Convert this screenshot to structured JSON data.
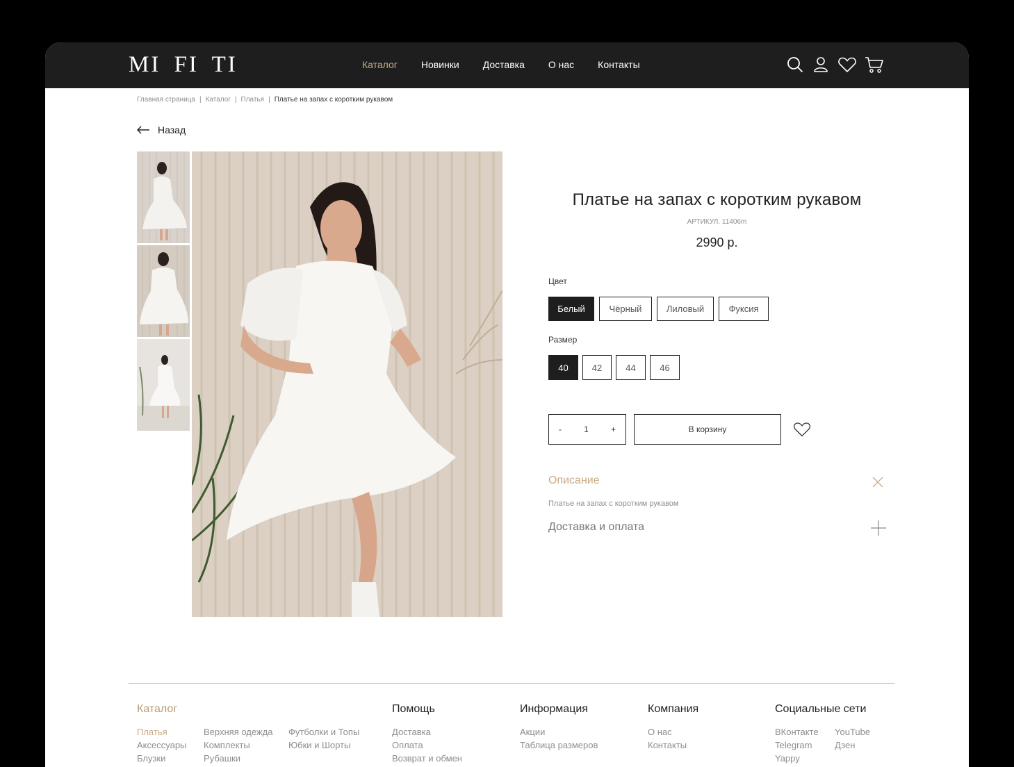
{
  "brand": {
    "logo": "MI FI TI"
  },
  "nav": {
    "items": [
      "Каталог",
      "Новинки",
      "Доставка",
      "О нас",
      "Контакты"
    ],
    "active": "Каталог"
  },
  "header_icons": [
    "search-icon",
    "user-icon",
    "heart-icon",
    "cart-icon"
  ],
  "breadcrumb": {
    "items": [
      "Главная страница",
      "Каталог",
      "Платья"
    ],
    "current": "Платье на запах с коротким рукавом"
  },
  "back_label": "Назад",
  "product": {
    "title": "Платье на запах с коротким рукавом",
    "article": "АРТИКУЛ. 11406m",
    "price": "2990 р.",
    "color_label": "Цвет",
    "colors": [
      "Белый",
      "Чёрный",
      "Лиловый",
      "Фуксия"
    ],
    "selected_color": "Белый",
    "size_label": "Размер",
    "sizes": [
      "40",
      "42",
      "44",
      "46"
    ],
    "selected_size": "40",
    "quantity": "1",
    "qty_minus": "-",
    "qty_plus": "+",
    "add_to_cart": "В корзину"
  },
  "accordion": {
    "description_title": "Описание",
    "description_text": "Платье на запах с коротким рукавом",
    "delivery_title": "Доставка и оплата"
  },
  "footer": {
    "catalog_title": "Каталог",
    "catalog_col1": [
      "Платья",
      "Аксессуары",
      "Блузки"
    ],
    "catalog_col2": [
      "Верхняя одежда",
      "Комплекты",
      "Рубашки"
    ],
    "catalog_col3": [
      "Футболки и Топы",
      "Юбки и Шорты"
    ],
    "help_title": "Помощь",
    "help_links": [
      "Доставка",
      "Оплата",
      "Возврат и обмен"
    ],
    "info_title": "Информация",
    "info_links": [
      "Акции",
      "Таблица размеров"
    ],
    "company_title": "Компания",
    "company_links": [
      "О нас",
      "Контакты"
    ],
    "social_title": "Социальные сети",
    "social_col1": [
      "ВКонтакте",
      "Telegram",
      "Yappy"
    ],
    "social_col2": [
      "YouTube",
      "Дзен"
    ]
  },
  "colors": {
    "header_bg": "#1e1e1e",
    "accent_gold": "#c8ab85",
    "selected_bg": "#1e1e1e"
  }
}
